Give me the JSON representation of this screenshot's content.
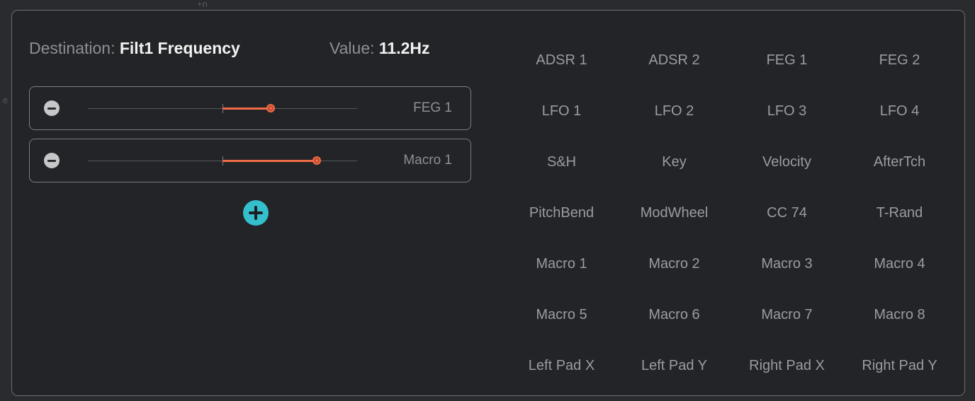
{
  "backdrop": {
    "top_mark": "+n",
    "left_mark": "e"
  },
  "header": {
    "destination_label": "Destination:",
    "destination_value": "Filt1 Frequency",
    "value_label": "Value:",
    "value_value": "11.2Hz"
  },
  "rows": [
    {
      "source": "FEG 1",
      "amount_pct": 68
    },
    {
      "source": "Macro 1",
      "amount_pct": 85
    }
  ],
  "sources": [
    [
      "ADSR 1",
      "ADSR 2",
      "FEG 1",
      "FEG 2"
    ],
    [
      "LFO 1",
      "LFO 2",
      "LFO 3",
      "LFO 4"
    ],
    [
      "S&H",
      "Key",
      "Velocity",
      "AfterTch"
    ],
    [
      "PitchBend",
      "ModWheel",
      "CC 74",
      "T-Rand"
    ],
    [
      "Macro 1",
      "Macro 2",
      "Macro 3",
      "Macro 4"
    ],
    [
      "Macro 5",
      "Macro 6",
      "Macro 7",
      "Macro 8"
    ],
    [
      "Left Pad X",
      "Left Pad Y",
      "Right Pad X",
      "Right Pad Y"
    ]
  ],
  "colors": {
    "accent_fill": "#f06a45",
    "add_button": "#34bfcc",
    "panel_bg": "#232427"
  },
  "icons": {
    "remove": "minus-circle-icon",
    "add": "plus-circle-icon"
  }
}
